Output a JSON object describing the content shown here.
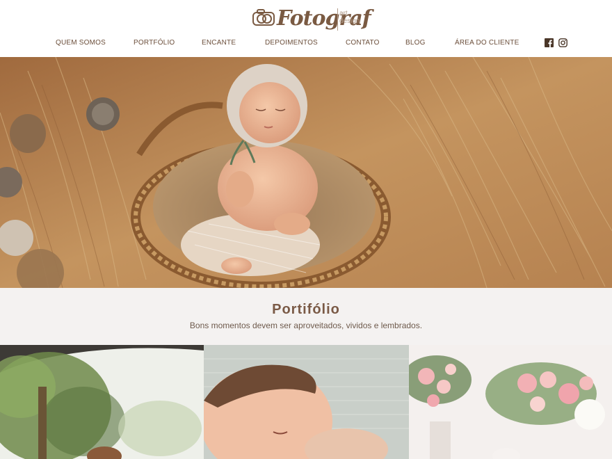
{
  "logo": {
    "name": "Fotograf",
    "sub_line1": "art",
    "sub_line2": "design"
  },
  "nav": {
    "items": [
      {
        "label": "QUEM SOMOS"
      },
      {
        "label": "PORTFÓLIO"
      },
      {
        "label": "ENCANTE"
      },
      {
        "label": "DEPOIMENTOS"
      },
      {
        "label": "CONTATO"
      },
      {
        "label": "BLOG"
      },
      {
        "label": "ÁREA DO CLIENTE"
      }
    ],
    "social": [
      "facebook-icon",
      "instagram-icon"
    ]
  },
  "hero": {
    "slide_count": 14,
    "active_slide": 1
  },
  "portfolio": {
    "title": "Portifólio",
    "subtitle": "Bons momentos devem ser aproveitados, vividos e lembrados."
  },
  "colors": {
    "brand": "#7a5a42",
    "nav_text": "#6b4e3a",
    "section_bg": "#f4f2f1"
  }
}
